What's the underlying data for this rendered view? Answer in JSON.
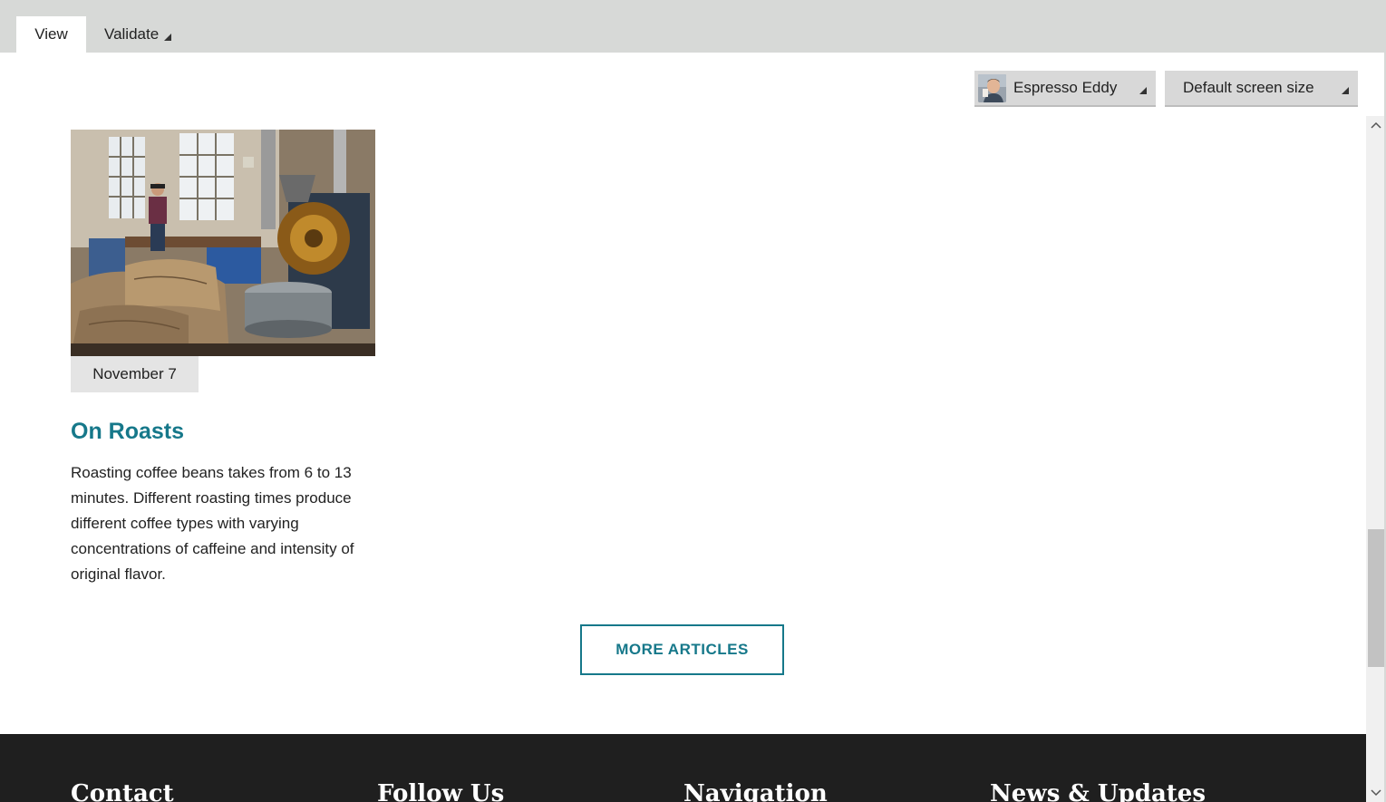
{
  "tabs": {
    "view_label": "View",
    "validate_label": "Validate"
  },
  "toolbar": {
    "persona_label": "Espresso Eddy",
    "screen_size_label": "Default screen size"
  },
  "article": {
    "image_description_icon": "coffee-roastery-photo",
    "date": "November 7",
    "title": "On Roasts",
    "body": "Roasting coffee beans takes from 6 to 13 minutes. Different roasting times produce different coffee types with varying concentrations of caffeine and intensity of original flavor."
  },
  "more_button_label": "MORE ARTICLES",
  "footer": {
    "contact_heading": "Contact",
    "follow_heading": "Follow Us",
    "navigation_heading": "Navigation",
    "news_heading": "News & Updates"
  },
  "colors": {
    "accent": "#16788a",
    "footer_bg": "#1f1f1f",
    "tabbar_bg": "#d7d9d7"
  }
}
